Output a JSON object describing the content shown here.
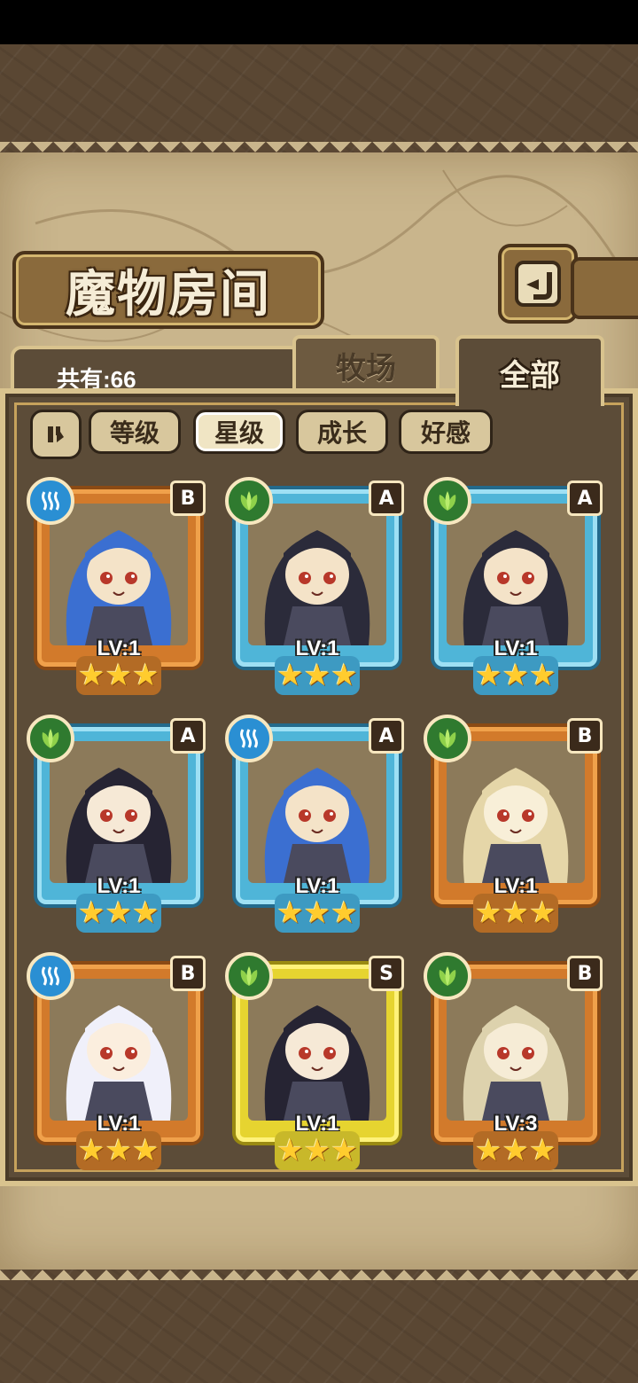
{
  "header": {
    "title": "魔物房间"
  },
  "count_label": "共有:66",
  "tabs": [
    {
      "label": "牧场",
      "active": false
    },
    {
      "label": "全部",
      "active": true
    }
  ],
  "sort_buttons": [
    {
      "label": "等级",
      "active": false
    },
    {
      "label": "星级",
      "active": true
    },
    {
      "label": "成长",
      "active": false
    },
    {
      "label": "好感",
      "active": false
    }
  ],
  "colors": {
    "rank_B": "#d27a2b",
    "rank_A": "#4fb5d8",
    "rank_S": "#e6d430",
    "element_water": "#2a8fd3",
    "element_leaf": "#2f7a2f",
    "star": "#ffcc2e"
  },
  "monsters": [
    {
      "rank": "B",
      "element": "water",
      "level": "LV:1",
      "stars": 3
    },
    {
      "rank": "A",
      "element": "leaf",
      "level": "LV:1",
      "stars": 3
    },
    {
      "rank": "A",
      "element": "leaf",
      "level": "LV:1",
      "stars": 3
    },
    {
      "rank": "A",
      "element": "leaf",
      "level": "LV:1",
      "stars": 3
    },
    {
      "rank": "A",
      "element": "water",
      "level": "LV:1",
      "stars": 3
    },
    {
      "rank": "B",
      "element": "leaf",
      "level": "LV:1",
      "stars": 3
    },
    {
      "rank": "B",
      "element": "water",
      "level": "LV:1",
      "stars": 3
    },
    {
      "rank": "S",
      "element": "leaf",
      "level": "LV:1",
      "stars": 3
    },
    {
      "rank": "B",
      "element": "leaf",
      "level": "LV:3",
      "stars": 3
    }
  ]
}
